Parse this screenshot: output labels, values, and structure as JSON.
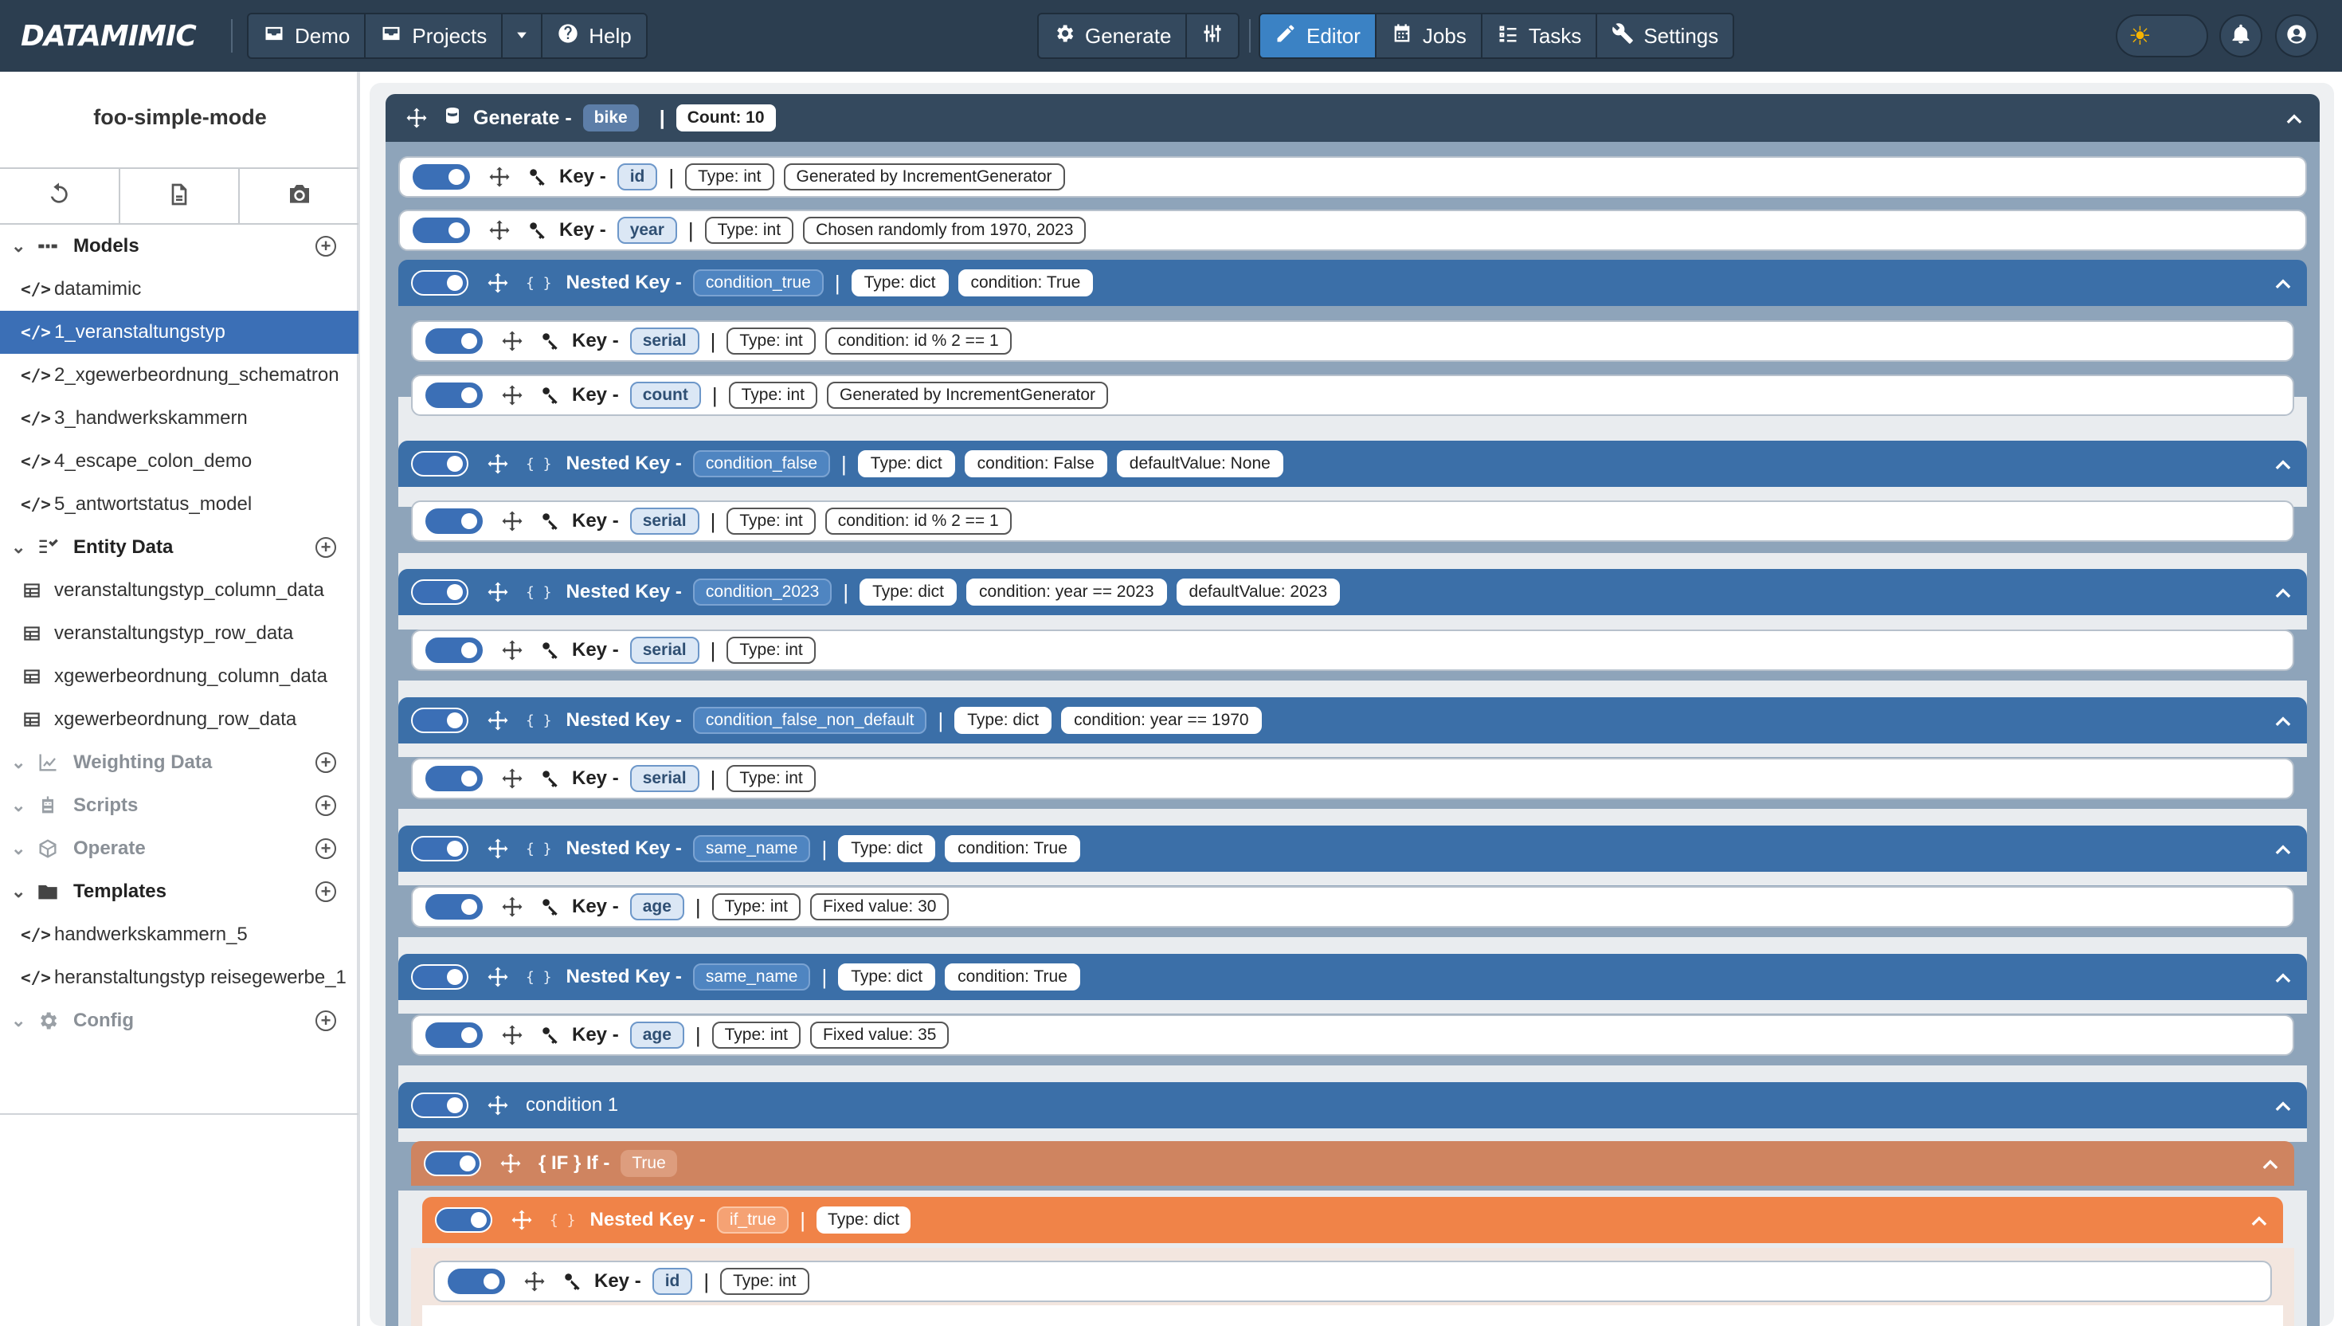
{
  "navbar": {
    "brand": "DATAMIMIC",
    "demo": "Demo",
    "projects": "Projects",
    "help": "Help",
    "generate": "Generate",
    "editor": "Editor",
    "jobs": "Jobs",
    "tasks": "Tasks",
    "settings": "Settings",
    "theme_icon": "☀"
  },
  "sidebar": {
    "project_title": "foo-simple-mode",
    "models_label": "Models",
    "models": [
      "datamimic",
      "1_veranstaltungstyp",
      "2_xgewerbeordnung_schematron",
      "3_handwerkskammern",
      "4_escape_colon_demo",
      "5_antwortstatus_model"
    ],
    "entity_label": "Entity Data",
    "entity": [
      "veranstaltungstyp_column_data",
      "veranstaltungstyp_row_data",
      "xgewerbeordnung_column_data",
      "xgewerbeordnung_row_data"
    ],
    "weighting_label": "Weighting Data",
    "scripts_label": "Scripts",
    "operate_label": "Operate",
    "templates_label": "Templates",
    "templates": [
      "handwerkskammern_5",
      "heranstaltungstyp reisegewerbe_1"
    ],
    "config_label": "Config"
  },
  "editor": {
    "gen_label": "Generate -",
    "gen_name": "bike",
    "gen_count": "Count: 10",
    "key_label": "Key -",
    "nested_label": "Nested Key -",
    "if_label": "{ IF }  If -",
    "sep": "|",
    "rows": {
      "id": {
        "name": "id",
        "type": "Type: int",
        "extra": "Generated by IncrementGenerator"
      },
      "year": {
        "name": "year",
        "type": "Type: int",
        "extra": "Chosen randomly from 1970, 2023"
      },
      "n1": {
        "name": "condition_true",
        "type": "Type: dict",
        "cond": "condition: True"
      },
      "n1k1": {
        "name": "serial",
        "type": "Type: int",
        "cond": "condition: id % 2 == 1"
      },
      "n1k2": {
        "name": "count",
        "type": "Type: int",
        "extra": "Generated by IncrementGenerator"
      },
      "n2": {
        "name": "condition_false",
        "type": "Type: dict",
        "cond": "condition: False",
        "default": "defaultValue: None"
      },
      "n2k1": {
        "name": "serial",
        "type": "Type: int",
        "cond": "condition: id % 2 == 1"
      },
      "n3": {
        "name": "condition_2023",
        "type": "Type: dict",
        "cond": "condition: year == 2023",
        "default": "defaultValue: 2023"
      },
      "n3k1": {
        "name": "serial",
        "type": "Type: int"
      },
      "n4": {
        "name": "condition_false_non_default",
        "type": "Type: dict",
        "cond": "condition: year == 1970"
      },
      "n4k1": {
        "name": "serial",
        "type": "Type: int"
      },
      "n5": {
        "name": "same_name",
        "type": "Type: dict",
        "cond": "condition: True"
      },
      "n5k1": {
        "name": "age",
        "type": "Type: int",
        "extra": "Fixed value: 30"
      },
      "n6": {
        "name": "same_name",
        "type": "Type: dict",
        "cond": "condition: True"
      },
      "n6k1": {
        "name": "age",
        "type": "Type: int",
        "extra": "Fixed value: 35"
      },
      "cond1": {
        "label": "condition 1"
      },
      "if1": {
        "value": "True"
      },
      "iftrue": {
        "name": "if_true",
        "type": "Type: dict"
      },
      "iftruek1": {
        "name": "id",
        "type": "Type: int"
      }
    }
  },
  "colors": {
    "navbar": "#2c3e50",
    "active_tab": "#3b82c4",
    "nested_header": "#3b6fa8",
    "if_header": "#cf8460",
    "if_true_header": "#f08348",
    "selected_item": "#3b6fb6"
  }
}
